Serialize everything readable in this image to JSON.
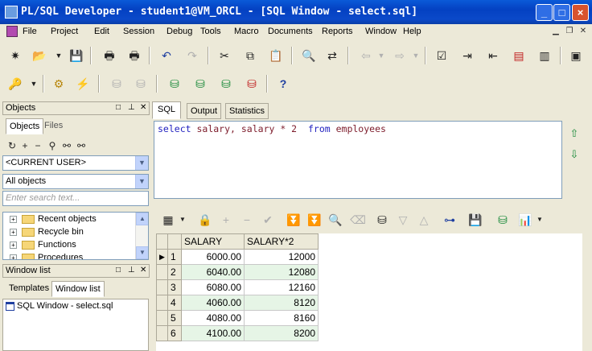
{
  "window": {
    "title": "PL/SQL Developer - student1@VM_ORCL - [SQL Window - select.sql]",
    "minimize": "_",
    "maximize": "□",
    "close": "×"
  },
  "menu": {
    "items": [
      "File",
      "Project",
      "Edit",
      "Session",
      "Debug",
      "Tools",
      "Macro",
      "Documents",
      "Reports",
      "Window",
      "Help"
    ]
  },
  "objects_panel": {
    "title": "Objects",
    "tabs": [
      "Objects",
      "Files"
    ],
    "user_combo": "<CURRENT USER>",
    "filter_combo": "All objects",
    "search_placeholder": "Enter search text...",
    "tree": [
      "Recent objects",
      "Recycle bin",
      "Functions",
      "Procedures"
    ]
  },
  "window_list": {
    "title": "Window list",
    "tabs": [
      "Templates",
      "Window list"
    ],
    "items": [
      "SQL Window - select.sql"
    ]
  },
  "editor": {
    "tabs": [
      "SQL",
      "Output",
      "Statistics"
    ],
    "sql": {
      "kw1": "select",
      "part1": "salary, salary * 2",
      "kw2": "from",
      "part2": "employees"
    }
  },
  "results": {
    "columns": [
      "SALARY",
      "SALARY*2"
    ],
    "rows": [
      {
        "n": "1",
        "salary": "6000.00",
        "salary2": "12000"
      },
      {
        "n": "2",
        "salary": "6040.00",
        "salary2": "12080"
      },
      {
        "n": "3",
        "salary": "6080.00",
        "salary2": "12160"
      },
      {
        "n": "4",
        "salary": "4060.00",
        "salary2": "8120"
      },
      {
        "n": "5",
        "salary": "4080.00",
        "salary2": "8160"
      },
      {
        "n": "6",
        "salary": "4100.00",
        "salary2": "8200"
      }
    ]
  }
}
